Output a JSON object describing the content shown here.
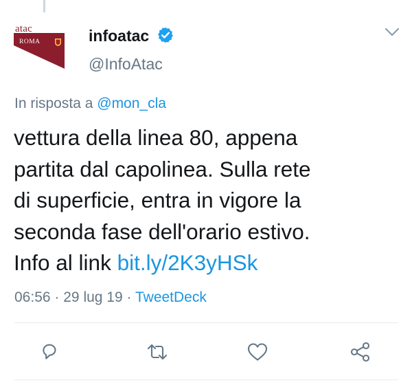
{
  "avatar": {
    "brand": "atac",
    "city": "ROMA",
    "brand_color": "#8b1d2c"
  },
  "author": {
    "name": "infoatac",
    "handle": "@InfoAtac",
    "verified_icon": "verified-badge-icon"
  },
  "reply": {
    "prefix": "In risposta a",
    "mention": "@mon_cla"
  },
  "tweet": {
    "text_lines": [
      "vettura della linea 80, appena",
      "partita dal capolinea. Sulla rete",
      "di superficie, entra in vigore la",
      "seconda fase dell'orario estivo."
    ],
    "last_line_prefix": "Info al link",
    "link": "bit.ly/2K3yHSk"
  },
  "meta": {
    "time": "06:56",
    "separator": "·",
    "date": "29 lug 19",
    "source": "TweetDeck"
  },
  "actions": [
    {
      "name": "reply",
      "icon": "reply-icon"
    },
    {
      "name": "retweet",
      "icon": "retweet-icon"
    },
    {
      "name": "like",
      "icon": "heart-icon"
    },
    {
      "name": "share",
      "icon": "share-icon"
    }
  ],
  "colors": {
    "link": "#1b95e0",
    "secondary_text": "#657786",
    "primary_text": "#14171a",
    "icon": "#657786",
    "divider": "#e6ecf0"
  }
}
